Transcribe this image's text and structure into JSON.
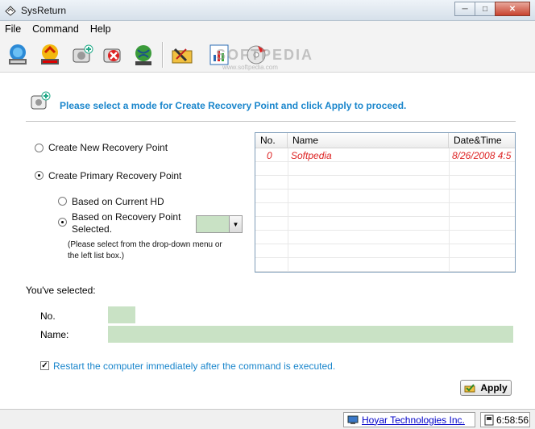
{
  "window": {
    "title": "SysReturn",
    "min_glyph": "─",
    "max_glyph": "□",
    "close_glyph": "✕"
  },
  "menu": [
    {
      "label": "File"
    },
    {
      "label": "Command"
    },
    {
      "label": "Help"
    }
  ],
  "toolbar": {
    "buttons": [
      "restore-icon",
      "create-recovery-point-icon",
      "add-hd-icon",
      "delete-icon",
      "network-globe-icon",
      "tools-folder-icon",
      "report-chart-icon",
      "disc-icon"
    ],
    "watermark": "SOFTPEDIA",
    "watermark_url": "www.softpedia.com"
  },
  "header": {
    "text": "Please select a mode for Create Recovery Point and click Apply to proceed."
  },
  "options": {
    "new_point": "Create New Recovery Point",
    "primary_point": "Create Primary Recovery Point",
    "based_current_hd": "Based on Current HD",
    "based_on_point_line1": "Based on Recovery Point",
    "based_on_point_line2": "Selected.",
    "combo_value": "",
    "note_line1": "(Please select from the drop-down menu or",
    "note_line2": "the left list box.)"
  },
  "list": {
    "columns": [
      "No.",
      "Name",
      "Date&Time"
    ],
    "rows": [
      {
        "no": "0",
        "name": "Softpedia",
        "datetime": "8/26/2008 4:5"
      }
    ]
  },
  "selection": {
    "heading": "You've selected:",
    "no_label": "No.",
    "name_label": "Name:",
    "no_value": "",
    "name_value": ""
  },
  "restart": {
    "checked": true,
    "mark": "✓",
    "label": "Restart the computer immediately after the command is executed."
  },
  "apply_label": "Apply",
  "status": {
    "company": "Hoyar Technologies Inc.",
    "time": "6:58:56"
  },
  "colors": {
    "accent_blue": "#1a86cc",
    "field_green": "#c9e2c5",
    "list_red": "#d22222"
  }
}
